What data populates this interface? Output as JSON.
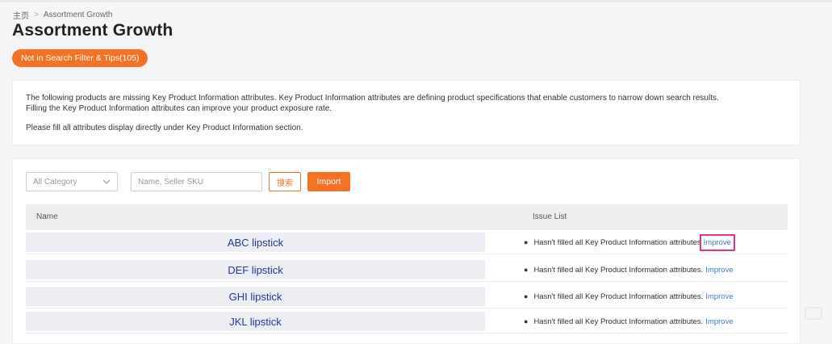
{
  "breadcrumb": {
    "home": "主页",
    "current": "Assortment Growth"
  },
  "page": {
    "title": "Assortment Growth"
  },
  "tab": {
    "label": "Not in Search Filter & Tips(105)"
  },
  "notice": {
    "line1": "The following products are missing Key Product Information attributes. Key Product Information attributes are defining product specifications that enable customers to narrow down search results.",
    "line2": "Filling the Key Product Information attributes can improve your product exposure rate.",
    "line3": "Please fill all attributes display directly under Key Product Information section."
  },
  "filters": {
    "category_selected": "All Category",
    "search_placeholder": "Name, Seller SKU",
    "search_button": "搜索",
    "import_button": "Import"
  },
  "table": {
    "headers": {
      "name": "Name",
      "issue": "Issue List"
    },
    "rows": [
      {
        "name": "ABC lipstick",
        "issue": "Hasn't filled all Key Product Information attributes",
        "action": "Improve"
      },
      {
        "name": "DEF lipstick",
        "issue": "Hasn't filled all Key Product Information attributes.",
        "action": "Improve"
      },
      {
        "name": "GHI lipstick",
        "issue": "Hasn't filled all Key Product Information attributes.",
        "action": "Improve"
      },
      {
        "name": "JKL lipstick",
        "issue": "Hasn't filled all Key Product Information attributes.",
        "action": "Improve"
      }
    ]
  },
  "colors": {
    "accent": "#f57224",
    "link": "#3a7bd5",
    "name_text": "#1f3a93",
    "highlight": "#e6348a"
  }
}
